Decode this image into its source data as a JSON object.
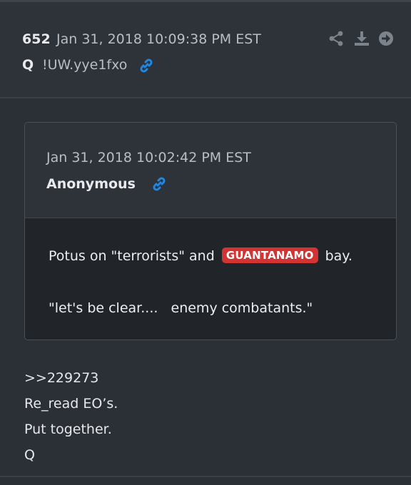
{
  "post": {
    "number": "652",
    "timestamp": "Jan 31, 2018 10:09:38 PM EST",
    "author": "Q",
    "tripcode": "!UW.yye1fxo",
    "actions": [
      "share-icon",
      "download-icon",
      "forward-icon"
    ],
    "body_lines": [
      ">>229273",
      "Re_read EO’s.",
      "Put together.",
      "Q"
    ]
  },
  "quoted": {
    "timestamp": "Jan 31, 2018 10:02:42 PM EST",
    "author": "Anonymous",
    "line1_before": "Potus on \"terrorists\" and",
    "tag": "GUANTANAMO",
    "line1_after": "bay.",
    "line2": "\"let's be clear....   enemy combatants.\""
  },
  "colors": {
    "background": "#2b2f36",
    "quote_body_bg": "#212429",
    "link_accent": "#1e88e5",
    "tag_red": "#d23434",
    "muted_text": "#b9bec5"
  }
}
